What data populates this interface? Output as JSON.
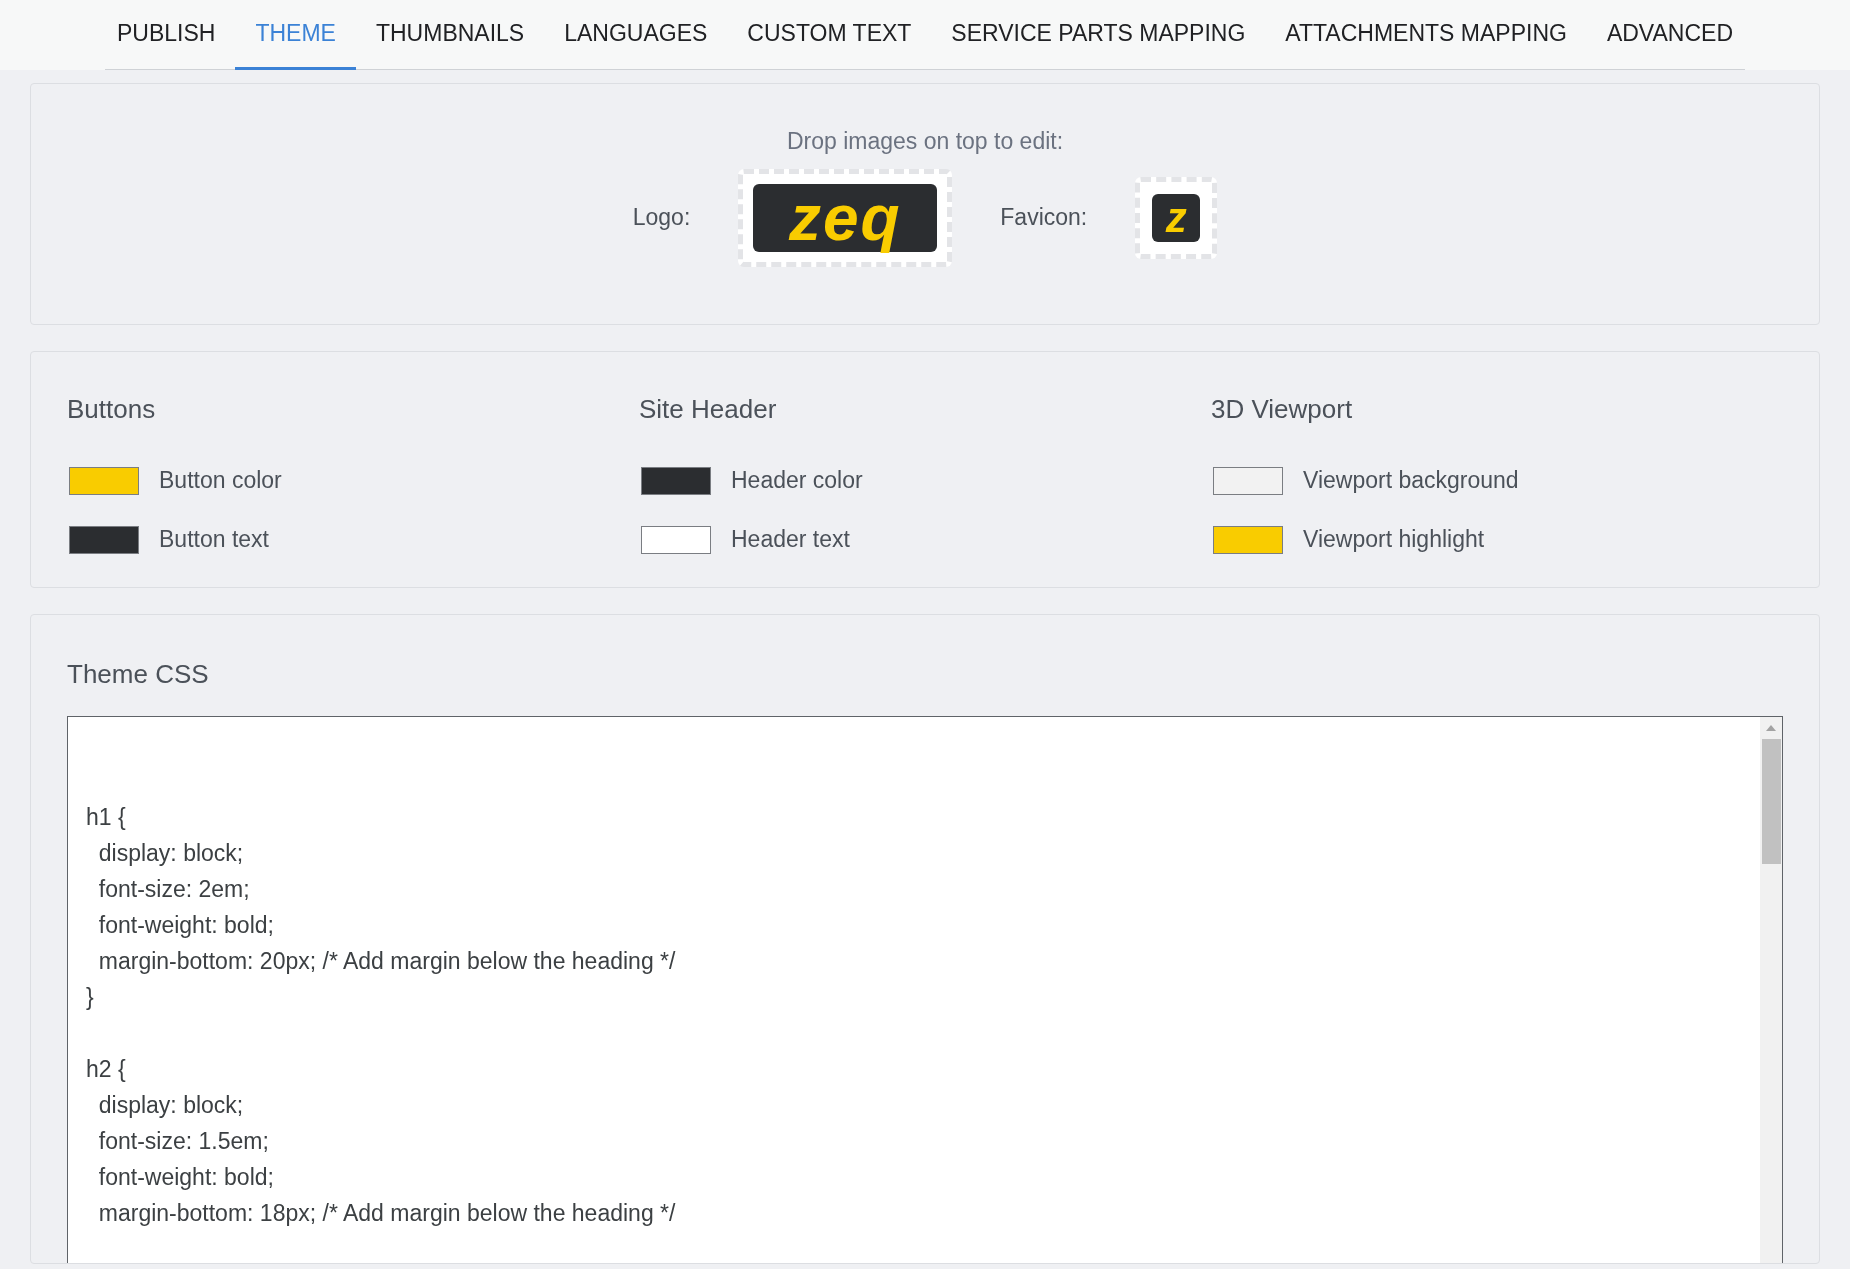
{
  "tabs": [
    {
      "label": "PUBLISH",
      "selected": false
    },
    {
      "label": "THEME",
      "selected": true
    },
    {
      "label": "THUMBNAILS",
      "selected": false
    },
    {
      "label": "LANGUAGES",
      "selected": false
    },
    {
      "label": "CUSTOM TEXT",
      "selected": false
    },
    {
      "label": "SERVICE PARTS MAPPING",
      "selected": false
    },
    {
      "label": "ATTACHMENTS MAPPING",
      "selected": false
    },
    {
      "label": "ADVANCED",
      "selected": false
    }
  ],
  "images": {
    "hint": "Drop images on top to edit:",
    "logo_label": "Logo:",
    "logo_text": "zeq",
    "favicon_label": "Favicon:",
    "favicon_text": "z"
  },
  "color_groups": [
    {
      "title": "Buttons",
      "items": [
        {
          "label": "Button color",
          "color": "#f9cc00"
        },
        {
          "label": "Button text",
          "color": "#2b2d30"
        }
      ]
    },
    {
      "title": "Site Header",
      "items": [
        {
          "label": "Header color",
          "color": "#2b2d30"
        },
        {
          "label": "Header text",
          "color": "#ffffff"
        }
      ]
    },
    {
      "title": "3D Viewport",
      "items": [
        {
          "label": "Viewport background",
          "color": "#f2f2f2"
        },
        {
          "label": "Viewport highlight",
          "color": "#f9cc00"
        }
      ]
    }
  ],
  "theme_css": {
    "title": "Theme CSS",
    "blocks": [
      [
        "h1 {",
        "  display: block;",
        "  font-size: 2em;",
        "  font-weight: bold;",
        "  margin-bottom: 20px; /* Add margin below the heading */",
        "}"
      ],
      [
        "h2 {",
        "  display: block;",
        "  font-size: 1.5em;",
        "  font-weight: bold;",
        "  margin-bottom: 18px; /* Add margin below the heading */"
      ]
    ]
  }
}
